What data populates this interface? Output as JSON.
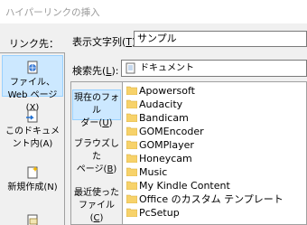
{
  "dialog": {
    "title": "ハイパーリンクの挿入"
  },
  "link_to": {
    "label": "リンク先：",
    "items": [
      {
        "label": "ファイル、Web ページ(X)",
        "icon": "globe-file-icon"
      },
      {
        "label": "このドキュメント内(A)",
        "icon": "document-arrow-icon"
      },
      {
        "label": "新規作成(N)",
        "icon": "new-document-icon"
      },
      {
        "label": "",
        "icon": "email-icon"
      }
    ]
  },
  "display_text": {
    "label": "表示文字列(T):",
    "value": "サンプル"
  },
  "search_in": {
    "label": "検索先(L):",
    "value": "ドキュメント",
    "icon": "documents-folder-icon"
  },
  "browse": {
    "items": [
      {
        "label": "現在のフォルダー(U)"
      },
      {
        "label": "ブラウズしたページ(B)"
      },
      {
        "label": "最近使ったファイル(C)"
      }
    ]
  },
  "files": [
    {
      "name": "Apowersoft"
    },
    {
      "name": "Audacity"
    },
    {
      "name": "Bandicam"
    },
    {
      "name": "GOMEncoder"
    },
    {
      "name": "GOMPlayer"
    },
    {
      "name": "Honeycam"
    },
    {
      "name": "Music"
    },
    {
      "name": "My Kindle Content"
    },
    {
      "name": "Office のカスタム テンプレート"
    },
    {
      "name": "PcSetup"
    }
  ],
  "colors": {
    "folder": "#f7d26a",
    "selection": "#cce8ff"
  }
}
